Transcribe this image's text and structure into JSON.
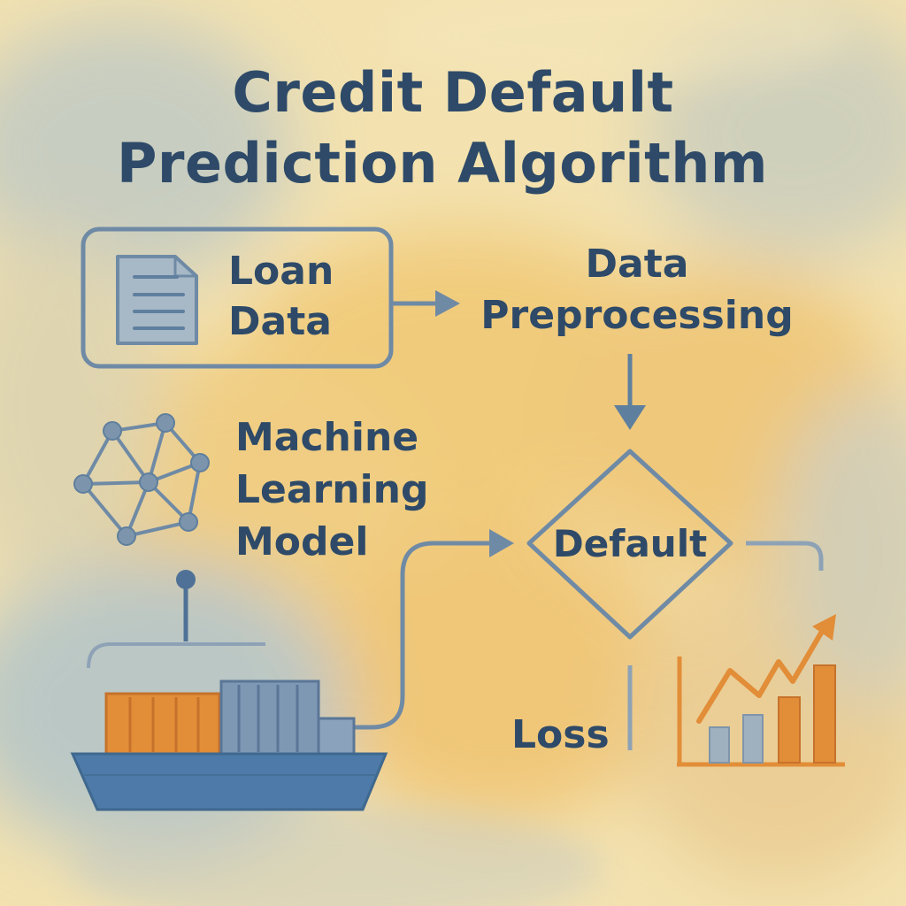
{
  "title": {
    "line1": "Credit Default",
    "line2": "Prediction Algorithm"
  },
  "nodes": {
    "loan_data": {
      "line1": "Loan",
      "line2": "Data",
      "icon": "document-icon"
    },
    "preprocessing": {
      "line1": "Data",
      "line2": "Preprocessing"
    },
    "model": {
      "line1": "Machine",
      "line2": "Learning",
      "line3": "Model",
      "icon": "network-icon"
    },
    "decision": {
      "label": "Default"
    },
    "loss": {
      "label": "Loss"
    }
  },
  "decorations": [
    "cargo-ship-icon",
    "bar-chart-icon"
  ],
  "colors": {
    "ink": "#2e4a68",
    "line": "#5f7f9e",
    "orange": "#e08a34",
    "ship": "#4d7aa8",
    "paper": "#f2dfaa"
  }
}
